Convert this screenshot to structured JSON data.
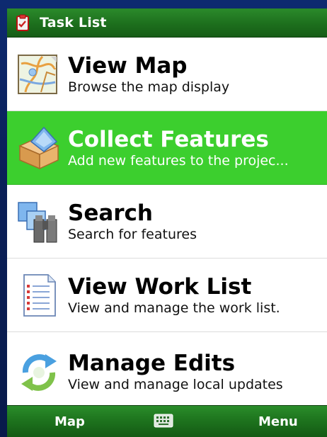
{
  "header": {
    "title": "Task List",
    "icon": "clipboard-icon"
  },
  "tasks": [
    {
      "title": "View Map",
      "subtitle": "Browse the map display",
      "icon": "map-icon",
      "selected": false
    },
    {
      "title": "Collect Features",
      "subtitle": "Add new features to the projec...",
      "icon": "box-icon",
      "selected": true
    },
    {
      "title": "Search",
      "subtitle": "Search for features",
      "icon": "binoculars-icon",
      "selected": false
    },
    {
      "title": "View Work List",
      "subtitle": "View and manage the work list.",
      "icon": "document-list-icon",
      "selected": false
    },
    {
      "title": "Manage Edits",
      "subtitle": "View and manage local updates",
      "icon": "sync-arrows-icon",
      "selected": false
    }
  ],
  "softbar": {
    "left_label": "Map",
    "right_label": "Menu",
    "center_icon": "keyboard-icon"
  },
  "colors": {
    "titlebar": "#1d6f1d",
    "selected_row": "#3ccf2e",
    "frame": "#0b1f55"
  }
}
